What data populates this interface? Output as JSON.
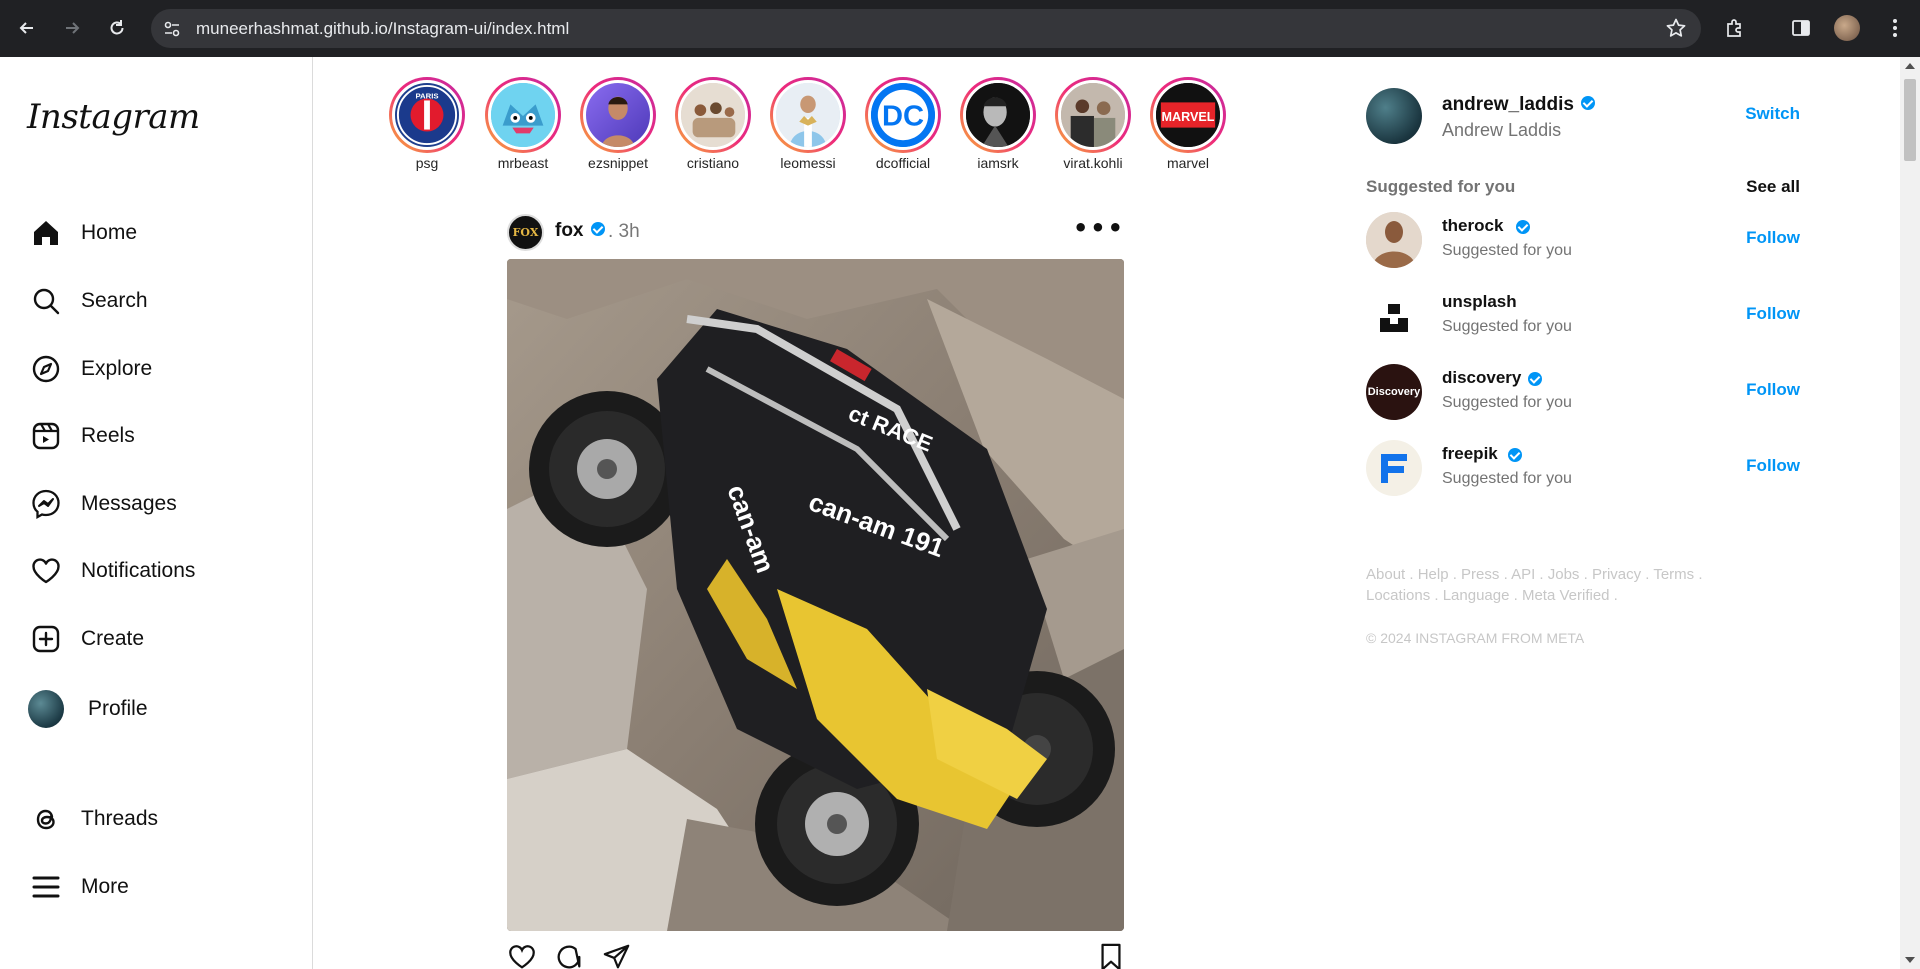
{
  "browser": {
    "url": "muneerhashmat.github.io/Instagram-ui/index.html"
  },
  "sidebar": {
    "logo": "Instagram",
    "items": [
      {
        "label": "Home",
        "icon": "home-icon"
      },
      {
        "label": "Search",
        "icon": "search-icon"
      },
      {
        "label": "Explore",
        "icon": "compass-icon"
      },
      {
        "label": "Reels",
        "icon": "reels-icon"
      },
      {
        "label": "Messages",
        "icon": "messenger-icon"
      },
      {
        "label": "Notifications",
        "icon": "heart-icon"
      },
      {
        "label": "Create",
        "icon": "plus-square-icon"
      },
      {
        "label": "Profile",
        "icon": "profile-avatar"
      },
      {
        "label": "Threads",
        "icon": "threads-icon"
      },
      {
        "label": "More",
        "icon": "menu-icon"
      }
    ]
  },
  "stories": [
    {
      "name": "psg"
    },
    {
      "name": "mrbeast"
    },
    {
      "name": "ezsnippet"
    },
    {
      "name": "cristiano"
    },
    {
      "name": "leomessi"
    },
    {
      "name": "dcofficial"
    },
    {
      "name": "iamsrk"
    },
    {
      "name": "virat.kohli"
    },
    {
      "name": "marvel"
    }
  ],
  "story_badges": {
    "psg": "PARIS",
    "dc": "DC",
    "marvel": "MARVEL"
  },
  "post": {
    "user": "fox",
    "time": ". 3h",
    "avatar_text": "FOX"
  },
  "profile": {
    "username": "andrew_laddis",
    "fullname": "Andrew Laddis",
    "switch_label": "Switch"
  },
  "suggestions": {
    "title": "Suggested for you",
    "see_all": "See all",
    "items": [
      {
        "name": "therock",
        "sub": "Suggested for you",
        "action": "Follow"
      },
      {
        "name": "unsplash",
        "sub": "Suggested for you",
        "action": "Follow"
      },
      {
        "name": "discovery",
        "sub": "Suggested for you",
        "action": "Follow"
      },
      {
        "name": "freepik",
        "sub": "Suggested for you",
        "action": "Follow"
      }
    ],
    "discovery_logo_text": "Discovery"
  },
  "footer": {
    "links_line1": "About . Help . Press . API . Jobs . Privacy . Terms .",
    "links_line2": "Locations . Language . Meta Verified .",
    "copyright": "© 2024 INSTAGRAM FROM META"
  },
  "colors": {
    "accent": "#0095f6",
    "chrome_bg": "#202124",
    "omnibox_bg": "#35363a"
  }
}
